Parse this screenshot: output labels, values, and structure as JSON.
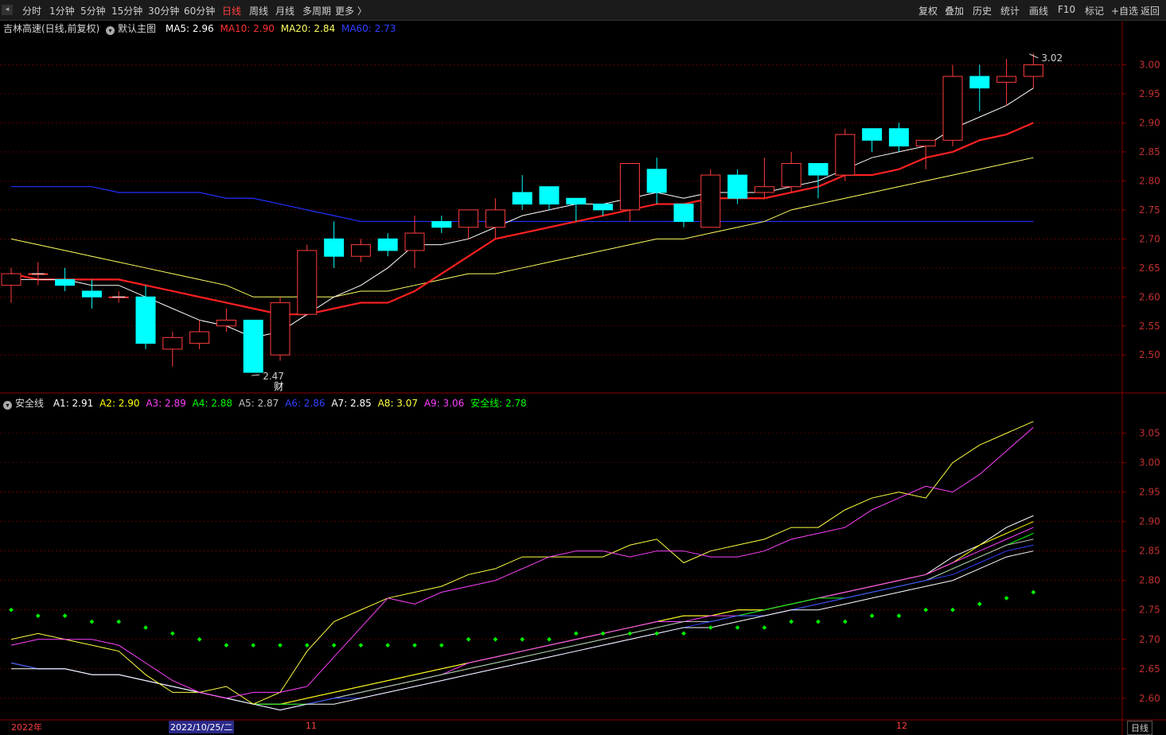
{
  "toolbar": {
    "periods": [
      "分时",
      "1分钟",
      "5分钟",
      "15分钟",
      "30分钟",
      "60分钟",
      "日线",
      "周线",
      "月线",
      "多周期",
      "更多 〉"
    ],
    "active_period": "日线",
    "tools": [
      "复权",
      "叠加",
      "历史",
      "统计",
      "画线",
      "F10",
      "标记",
      "+自选",
      "返回"
    ]
  },
  "main_info": {
    "stock": "吉林高速(日线,前复权)",
    "template": "默认主图",
    "ma5": "MA5: 2.96",
    "ma10": "MA10: 2.90",
    "ma20": "MA20: 2.84",
    "ma60": "MA60: 2.73"
  },
  "sub_info": {
    "name": "安全线",
    "a1": "A1: 2.91",
    "a2": "A2: 2.90",
    "a3": "A3: 2.89",
    "a4": "A4: 2.88",
    "a5": "A5: 2.87",
    "a6": "A6: 2.86",
    "a7": "A7: 2.85",
    "a8": "A8: 3.07",
    "a9": "A9: 3.06",
    "safe": "安全线: 2.78"
  },
  "annotations": {
    "high_marker": "3.02",
    "low_marker": "2.47",
    "finance_tag": "财"
  },
  "bottom_axis": {
    "year": "2022年",
    "cursor_date": "2022/10/25/二",
    "month_nov": "11",
    "month_dec": "12",
    "period_label": "日线"
  },
  "colors": {
    "up": "#ff3c3c",
    "down": "#00ffff",
    "ma5": "#ffffff",
    "ma10": "#ff2020",
    "ma20": "#ffff60",
    "ma60": "#2030ff",
    "grid": "#8b0000",
    "safe_dot": "#00ff00"
  },
  "chart_data": [
    {
      "type": "candlestick",
      "yaxis_ticks": [
        2.5,
        2.55,
        2.6,
        2.65,
        2.7,
        2.75,
        2.8,
        2.85,
        2.9,
        2.95,
        3.0
      ],
      "ylim": [
        2.44,
        3.05
      ],
      "candles": [
        {
          "o": 2.62,
          "h": 2.65,
          "l": 2.59,
          "c": 2.64
        },
        {
          "o": 2.64,
          "h": 2.66,
          "l": 2.62,
          "c": 2.64
        },
        {
          "o": 2.63,
          "h": 2.65,
          "l": 2.61,
          "c": 2.62
        },
        {
          "o": 2.61,
          "h": 2.63,
          "l": 2.58,
          "c": 2.6
        },
        {
          "o": 2.6,
          "h": 2.61,
          "l": 2.59,
          "c": 2.6
        },
        {
          "o": 2.6,
          "h": 2.62,
          "l": 2.51,
          "c": 2.52
        },
        {
          "o": 2.51,
          "h": 2.54,
          "l": 2.48,
          "c": 2.53
        },
        {
          "o": 2.52,
          "h": 2.56,
          "l": 2.51,
          "c": 2.54
        },
        {
          "o": 2.55,
          "h": 2.58,
          "l": 2.54,
          "c": 2.56
        },
        {
          "o": 2.56,
          "h": 2.56,
          "l": 2.47,
          "c": 2.47
        },
        {
          "o": 2.5,
          "h": 2.6,
          "l": 2.49,
          "c": 2.59
        },
        {
          "o": 2.57,
          "h": 2.69,
          "l": 2.57,
          "c": 2.68
        },
        {
          "o": 2.7,
          "h": 2.73,
          "l": 2.65,
          "c": 2.67
        },
        {
          "o": 2.67,
          "h": 2.7,
          "l": 2.66,
          "c": 2.69
        },
        {
          "o": 2.7,
          "h": 2.71,
          "l": 2.67,
          "c": 2.68
        },
        {
          "o": 2.68,
          "h": 2.74,
          "l": 2.65,
          "c": 2.71
        },
        {
          "o": 2.73,
          "h": 2.74,
          "l": 2.71,
          "c": 2.72
        },
        {
          "o": 2.72,
          "h": 2.75,
          "l": 2.7,
          "c": 2.75
        },
        {
          "o": 2.72,
          "h": 2.77,
          "l": 2.7,
          "c": 2.75
        },
        {
          "o": 2.78,
          "h": 2.81,
          "l": 2.75,
          "c": 2.76
        },
        {
          "o": 2.79,
          "h": 2.79,
          "l": 2.75,
          "c": 2.76
        },
        {
          "o": 2.77,
          "h": 2.77,
          "l": 2.73,
          "c": 2.76
        },
        {
          "o": 2.76,
          "h": 2.76,
          "l": 2.74,
          "c": 2.75
        },
        {
          "o": 2.75,
          "h": 2.83,
          "l": 2.73,
          "c": 2.83
        },
        {
          "o": 2.82,
          "h": 2.84,
          "l": 2.76,
          "c": 2.78
        },
        {
          "o": 2.76,
          "h": 2.76,
          "l": 2.72,
          "c": 2.73
        },
        {
          "o": 2.72,
          "h": 2.82,
          "l": 2.72,
          "c": 2.81
        },
        {
          "o": 2.81,
          "h": 2.82,
          "l": 2.76,
          "c": 2.77
        },
        {
          "o": 2.78,
          "h": 2.84,
          "l": 2.77,
          "c": 2.79
        },
        {
          "o": 2.79,
          "h": 2.85,
          "l": 2.78,
          "c": 2.83
        },
        {
          "o": 2.83,
          "h": 2.83,
          "l": 2.77,
          "c": 2.81
        },
        {
          "o": 2.81,
          "h": 2.89,
          "l": 2.8,
          "c": 2.88
        },
        {
          "o": 2.89,
          "h": 2.89,
          "l": 2.85,
          "c": 2.87
        },
        {
          "o": 2.89,
          "h": 2.9,
          "l": 2.85,
          "c": 2.86
        },
        {
          "o": 2.86,
          "h": 2.87,
          "l": 2.82,
          "c": 2.87
        },
        {
          "o": 2.87,
          "h": 3.0,
          "l": 2.86,
          "c": 2.98
        },
        {
          "o": 2.98,
          "h": 3.0,
          "l": 2.92,
          "c": 2.96
        },
        {
          "o": 2.97,
          "h": 3.01,
          "l": 2.93,
          "c": 2.98
        },
        {
          "o": 2.98,
          "h": 3.02,
          "l": 2.96,
          "c": 3.0
        }
      ],
      "ma5": [
        2.63,
        2.63,
        2.63,
        2.62,
        2.62,
        2.6,
        2.58,
        2.56,
        2.55,
        2.53,
        2.54,
        2.57,
        2.6,
        2.62,
        2.65,
        2.69,
        2.69,
        2.7,
        2.72,
        2.74,
        2.75,
        2.76,
        2.76,
        2.77,
        2.78,
        2.77,
        2.78,
        2.78,
        2.78,
        2.79,
        2.8,
        2.82,
        2.84,
        2.85,
        2.86,
        2.89,
        2.91,
        2.93,
        2.96
      ],
      "ma10": [
        2.64,
        2.63,
        2.63,
        2.63,
        2.63,
        2.62,
        2.61,
        2.6,
        2.59,
        2.58,
        2.57,
        2.57,
        2.58,
        2.59,
        2.59,
        2.61,
        2.64,
        2.67,
        2.7,
        2.71,
        2.72,
        2.73,
        2.74,
        2.75,
        2.76,
        2.76,
        2.77,
        2.77,
        2.77,
        2.78,
        2.79,
        2.81,
        2.81,
        2.82,
        2.84,
        2.85,
        2.87,
        2.88,
        2.9
      ],
      "ma20": [
        2.7,
        2.69,
        2.68,
        2.67,
        2.66,
        2.65,
        2.64,
        2.63,
        2.62,
        2.6,
        2.6,
        2.6,
        2.6,
        2.61,
        2.61,
        2.62,
        2.63,
        2.64,
        2.64,
        2.65,
        2.66,
        2.67,
        2.68,
        2.69,
        2.7,
        2.7,
        2.71,
        2.72,
        2.73,
        2.75,
        2.76,
        2.77,
        2.78,
        2.79,
        2.8,
        2.81,
        2.82,
        2.83,
        2.84
      ],
      "ma60": [
        2.79,
        2.79,
        2.79,
        2.79,
        2.78,
        2.78,
        2.78,
        2.78,
        2.77,
        2.77,
        2.76,
        2.75,
        2.74,
        2.73,
        2.73,
        2.73,
        2.73,
        2.73,
        2.73,
        2.73,
        2.73,
        2.73,
        2.73,
        2.73,
        2.73,
        2.73,
        2.73,
        2.73,
        2.73,
        2.73,
        2.73,
        2.73,
        2.73,
        2.73,
        2.73,
        2.73,
        2.73,
        2.73,
        2.73
      ]
    },
    {
      "type": "line",
      "yaxis_ticks": [
        2.6,
        2.65,
        2.7,
        2.75,
        2.8,
        2.85,
        2.9,
        2.95,
        3.0,
        3.05
      ],
      "ylim": [
        2.57,
        3.09
      ],
      "series": [
        {
          "name": "A1",
          "color": "#ffffff",
          "values": [
            2.66,
            2.65,
            2.65,
            2.64,
            2.64,
            2.63,
            2.62,
            2.61,
            2.6,
            2.59,
            2.59,
            2.6,
            2.61,
            2.62,
            2.63,
            2.64,
            2.65,
            2.66,
            2.67,
            2.68,
            2.69,
            2.7,
            2.71,
            2.72,
            2.73,
            2.74,
            2.74,
            2.75,
            2.75,
            2.76,
            2.77,
            2.78,
            2.79,
            2.8,
            2.81,
            2.84,
            2.86,
            2.89,
            2.91
          ]
        },
        {
          "name": "A2",
          "color": "#ffff00",
          "values": [
            2.66,
            2.65,
            2.65,
            2.64,
            2.64,
            2.63,
            2.62,
            2.61,
            2.6,
            2.59,
            2.59,
            2.6,
            2.61,
            2.62,
            2.63,
            2.64,
            2.65,
            2.66,
            2.67,
            2.68,
            2.69,
            2.7,
            2.71,
            2.72,
            2.73,
            2.74,
            2.74,
            2.75,
            2.75,
            2.76,
            2.77,
            2.78,
            2.79,
            2.8,
            2.81,
            2.83,
            2.86,
            2.88,
            2.9
          ]
        },
        {
          "name": "A3",
          "color": "#ff40ff",
          "values": [
            2.66,
            2.65,
            2.65,
            2.64,
            2.64,
            2.63,
            2.62,
            2.61,
            2.6,
            2.59,
            2.59,
            2.59,
            2.6,
            2.61,
            2.62,
            2.63,
            2.64,
            2.66,
            2.67,
            2.68,
            2.69,
            2.7,
            2.71,
            2.72,
            2.73,
            2.73,
            2.74,
            2.74,
            2.75,
            2.76,
            2.77,
            2.78,
            2.79,
            2.8,
            2.81,
            2.83,
            2.85,
            2.87,
            2.89
          ]
        },
        {
          "name": "A4",
          "color": "#00ff00",
          "values": [
            2.66,
            2.65,
            2.65,
            2.64,
            2.64,
            2.63,
            2.62,
            2.61,
            2.6,
            2.59,
            2.59,
            2.59,
            2.6,
            2.61,
            2.62,
            2.63,
            2.64,
            2.65,
            2.66,
            2.67,
            2.68,
            2.69,
            2.7,
            2.71,
            2.72,
            2.73,
            2.73,
            2.74,
            2.75,
            2.76,
            2.77,
            2.77,
            2.78,
            2.79,
            2.8,
            2.82,
            2.84,
            2.86,
            2.88
          ]
        },
        {
          "name": "A5",
          "color": "#c0c0c0",
          "values": [
            2.66,
            2.65,
            2.65,
            2.64,
            2.64,
            2.63,
            2.62,
            2.61,
            2.6,
            2.59,
            2.58,
            2.59,
            2.6,
            2.61,
            2.62,
            2.63,
            2.64,
            2.65,
            2.66,
            2.67,
            2.68,
            2.69,
            2.7,
            2.71,
            2.72,
            2.73,
            2.73,
            2.74,
            2.74,
            2.75,
            2.76,
            2.77,
            2.78,
            2.79,
            2.8,
            2.82,
            2.84,
            2.86,
            2.87
          ]
        },
        {
          "name": "A6",
          "color": "#3040ff",
          "values": [
            2.66,
            2.65,
            2.65,
            2.64,
            2.64,
            2.63,
            2.62,
            2.61,
            2.6,
            2.59,
            2.58,
            2.59,
            2.6,
            2.6,
            2.61,
            2.62,
            2.63,
            2.64,
            2.65,
            2.66,
            2.67,
            2.68,
            2.69,
            2.7,
            2.71,
            2.72,
            2.73,
            2.74,
            2.74,
            2.75,
            2.76,
            2.77,
            2.78,
            2.79,
            2.8,
            2.81,
            2.83,
            2.85,
            2.86
          ]
        },
        {
          "name": "A7",
          "color": "#ffffff",
          "values": [
            2.65,
            2.65,
            2.65,
            2.64,
            2.64,
            2.63,
            2.62,
            2.61,
            2.6,
            2.59,
            2.58,
            2.59,
            2.59,
            2.6,
            2.61,
            2.62,
            2.63,
            2.64,
            2.65,
            2.66,
            2.67,
            2.68,
            2.69,
            2.7,
            2.71,
            2.72,
            2.72,
            2.73,
            2.74,
            2.75,
            2.75,
            2.76,
            2.77,
            2.78,
            2.79,
            2.8,
            2.82,
            2.84,
            2.85
          ]
        },
        {
          "name": "A8",
          "color": "#ffff40",
          "values": [
            2.7,
            2.71,
            2.7,
            2.69,
            2.68,
            2.64,
            2.61,
            2.61,
            2.62,
            2.59,
            2.61,
            2.68,
            2.73,
            2.75,
            2.77,
            2.78,
            2.79,
            2.81,
            2.82,
            2.84,
            2.84,
            2.84,
            2.84,
            2.86,
            2.87,
            2.83,
            2.85,
            2.86,
            2.87,
            2.89,
            2.89,
            2.92,
            2.94,
            2.95,
            2.94,
            3.0,
            3.03,
            3.05,
            3.07
          ]
        },
        {
          "name": "A9",
          "color": "#ff40ff",
          "values": [
            2.69,
            2.7,
            2.7,
            2.7,
            2.69,
            2.66,
            2.63,
            2.61,
            2.6,
            2.61,
            2.61,
            2.62,
            2.67,
            2.72,
            2.77,
            2.76,
            2.78,
            2.79,
            2.8,
            2.82,
            2.84,
            2.85,
            2.85,
            2.84,
            2.85,
            2.85,
            2.84,
            2.84,
            2.85,
            2.87,
            2.88,
            2.89,
            2.92,
            2.94,
            2.96,
            2.95,
            2.98,
            3.02,
            3.06
          ]
        },
        {
          "name": "安全线",
          "color": "#00ff00",
          "dots": true,
          "values": [
            2.75,
            2.74,
            2.74,
            2.73,
            2.73,
            2.72,
            2.71,
            2.7,
            2.69,
            2.69,
            2.69,
            2.69,
            2.69,
            2.69,
            2.69,
            2.69,
            2.69,
            2.7,
            2.7,
            2.7,
            2.7,
            2.71,
            2.71,
            2.71,
            2.71,
            2.71,
            2.72,
            2.72,
            2.72,
            2.73,
            2.73,
            2.73,
            2.74,
            2.74,
            2.75,
            2.75,
            2.76,
            2.77,
            2.78
          ]
        }
      ]
    }
  ]
}
